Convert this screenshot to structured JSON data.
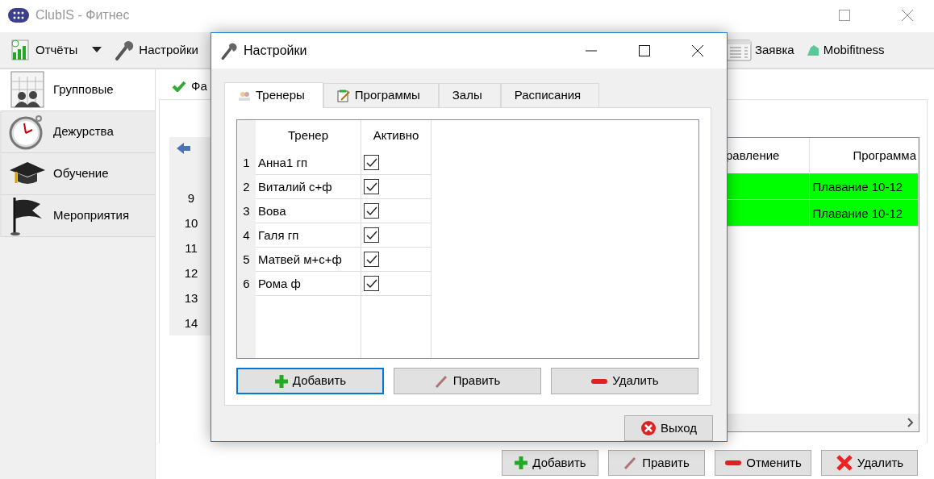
{
  "window": {
    "title": "ClubIS - Фитнес"
  },
  "toolbar": [
    {
      "label": "Отчёты",
      "dropdown": true
    },
    {
      "label": "Настройки",
      "dropdown": false
    },
    {
      "label": "Заявка",
      "dropdown": false
    },
    {
      "label": "Mobifitness",
      "dropdown": false
    }
  ],
  "sidebar": {
    "items": [
      {
        "label": "Групповые",
        "selected": true
      },
      {
        "label": "Дежурства",
        "selected": false
      },
      {
        "label": "Обучение",
        "selected": false
      },
      {
        "label": "Мероприятия",
        "selected": false
      }
    ]
  },
  "content": {
    "tab": {
      "label": "Фа",
      "selected": true
    },
    "row_numbers": [
      "9",
      "10",
      "11",
      "12",
      "13",
      "14"
    ],
    "table": {
      "columns": [
        "равление",
        "Программа"
      ],
      "rows": [
        {
          "cells": [
            "",
            "Плавание 10-12"
          ],
          "color": "#00ff00"
        },
        {
          "cells": [
            "",
            "Плавание 10-12"
          ],
          "color": "#00ff00"
        }
      ]
    },
    "buttons": [
      "Добавить",
      "Править",
      "Отменить",
      "Удалить"
    ]
  },
  "dialog": {
    "title": "Настройки",
    "tabs": [
      {
        "label": "Тренеры",
        "selected": true
      },
      {
        "label": "Программы",
        "selected": false
      },
      {
        "label": "Залы",
        "selected": false
      },
      {
        "label": "Расписания",
        "selected": false
      }
    ],
    "table": {
      "columns": [
        "Тренер",
        "Активно"
      ],
      "rows": [
        {
          "number": "1",
          "name": "Анна1 гп",
          "active": true
        },
        {
          "number": "2",
          "name": "Виталий с+ф",
          "active": true
        },
        {
          "number": "3",
          "name": "Вова",
          "active": true
        },
        {
          "number": "4",
          "name": "Галя гп",
          "active": true
        },
        {
          "number": "5",
          "name": "Матвей м+с+ф",
          "active": true
        },
        {
          "number": "6",
          "name": "Рома ф",
          "active": true
        }
      ]
    },
    "buttons": [
      {
        "label": "Добавить",
        "focused": true
      },
      {
        "label": "Править",
        "focused": false
      },
      {
        "label": "Удалить",
        "focused": false
      }
    ],
    "exit_button": "Выход"
  }
}
